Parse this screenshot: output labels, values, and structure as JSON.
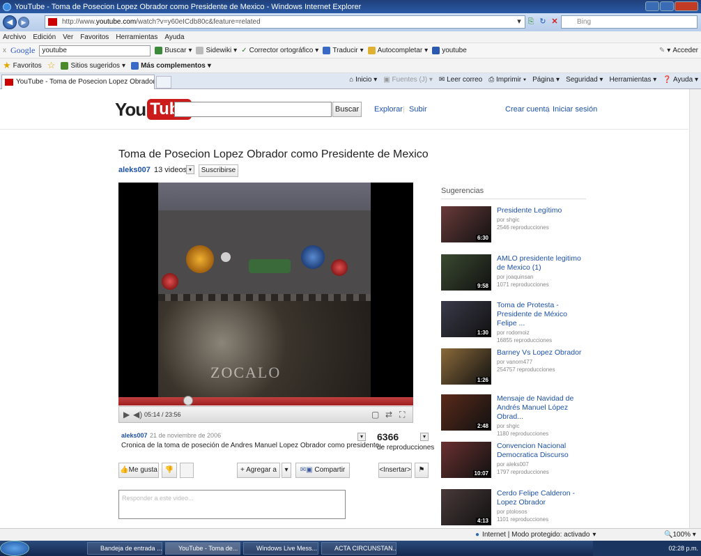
{
  "window": {
    "title": "YouTube - Toma de Posecion Lopez Obrador como Presidente de Mexico - Windows Internet Explorer"
  },
  "address": {
    "prefix": "http://www.",
    "host": "youtube.com",
    "path": "/watch?v=y60eICdb80c&feature=related",
    "search_placeholder": "Bing"
  },
  "menu": [
    "Archivo",
    "Edición",
    "Ver",
    "Favoritos",
    "Herramientas",
    "Ayuda"
  ],
  "google_toolbar": {
    "logo": "Google",
    "query": "youtube",
    "buscar": "Buscar",
    "sidewiki": "Sidewiki",
    "corrector": "Corrector ortográfico",
    "traducir": "Traducir",
    "autocompletar": "Autocompletar",
    "bookmark": "youtube",
    "acceder": "Acceder"
  },
  "favorites": {
    "label": "Favoritos",
    "suggested": "Sitios sugeridos",
    "more": "Más complementos"
  },
  "tab": {
    "title": "YouTube - Toma de Posecion Lopez Obrador co..."
  },
  "commandbar": [
    "Inicio",
    "Fuentes (J)",
    "Leer correo",
    "Imprimir",
    "Página",
    "Seguridad",
    "Herramientas",
    "Ayuda"
  ],
  "youtube": {
    "logo_you": "You",
    "logo_tube": "Tube",
    "search_button": "Buscar",
    "explore": "Explorar",
    "upload": "Subir",
    "create_account": "Crear cuenta",
    "sign_in": "Iniciar sesión",
    "video_title": "Toma de Posecion Lopez Obrador como Presidente de Mexico",
    "channel": "aleks007",
    "video_count": "13 videos",
    "subscribe": "Suscribirse",
    "overlay_text": "ZOCALO",
    "time": "05:14 / 23:56",
    "progress": 0.22,
    "info_user": "aleks007",
    "info_date": "21 de noviembre de 2006",
    "description": "Cronica de la toma de poseción de Andres Manuel Lopez Obrador como presidente...",
    "views": "6366",
    "views_label": "de reproducciones",
    "like": "Me gusta",
    "add_to": "Agregar a",
    "share": "Compartir",
    "embed": "<Insertar>",
    "comment_placeholder": "Responder a este video..."
  },
  "suggestions": {
    "title": "Sugerencias",
    "items": [
      {
        "title": "Presidente Legítimo",
        "by": "por shgic",
        "views": "2546 reproducciones",
        "duration": "6:30",
        "color": "#6a3a3a"
      },
      {
        "title": "AMLO presidente legitimo de Mexico (1)",
        "by": "por joaquinsan",
        "views": "1071 reproducciones",
        "duration": "9:58",
        "color": "#3a4a30"
      },
      {
        "title": "Toma de Protesta - Presidente de México Felipe ...",
        "by": "por rodomoiz",
        "views": "16855 reproducciones",
        "duration": "1:30",
        "color": "#3a3a4a"
      },
      {
        "title": "Barney Vs Lopez Obrador",
        "by": "por vanom477",
        "views": "254757 reproducciones",
        "duration": "1:26",
        "color": "#8a6a3a"
      },
      {
        "title": "Mensaje de Navidad de Andrés Manuel López Obrad...",
        "by": "por shgic",
        "views": "1180 reproducciones",
        "duration": "2:48",
        "color": "#5a2a1a"
      },
      {
        "title": "Convencion Nacional Democratica Discurso",
        "by": "por aleks007",
        "views": "1797 reproducciones",
        "duration": "10:07",
        "color": "#6a3030"
      },
      {
        "title": "Cerdo Felipe Calderon - Lopez Obrador",
        "by": "por ptolosos",
        "views": "1101 reproducciones",
        "duration": "4:13",
        "color": "#4a3a3a"
      }
    ]
  },
  "status": {
    "zone": "Internet | Modo protegido: activado",
    "zoom": "100%"
  },
  "taskbar": {
    "items": [
      "Bandeja de entrada ...",
      "YouTube - Toma de...",
      "Windows Live Mess...",
      "ACTA CIRCUNSTAN..."
    ],
    "clock": "02:28 p.m."
  },
  "colors": {
    "yt_red": "#cc1b1b",
    "link_blue": "#1c51a8"
  }
}
